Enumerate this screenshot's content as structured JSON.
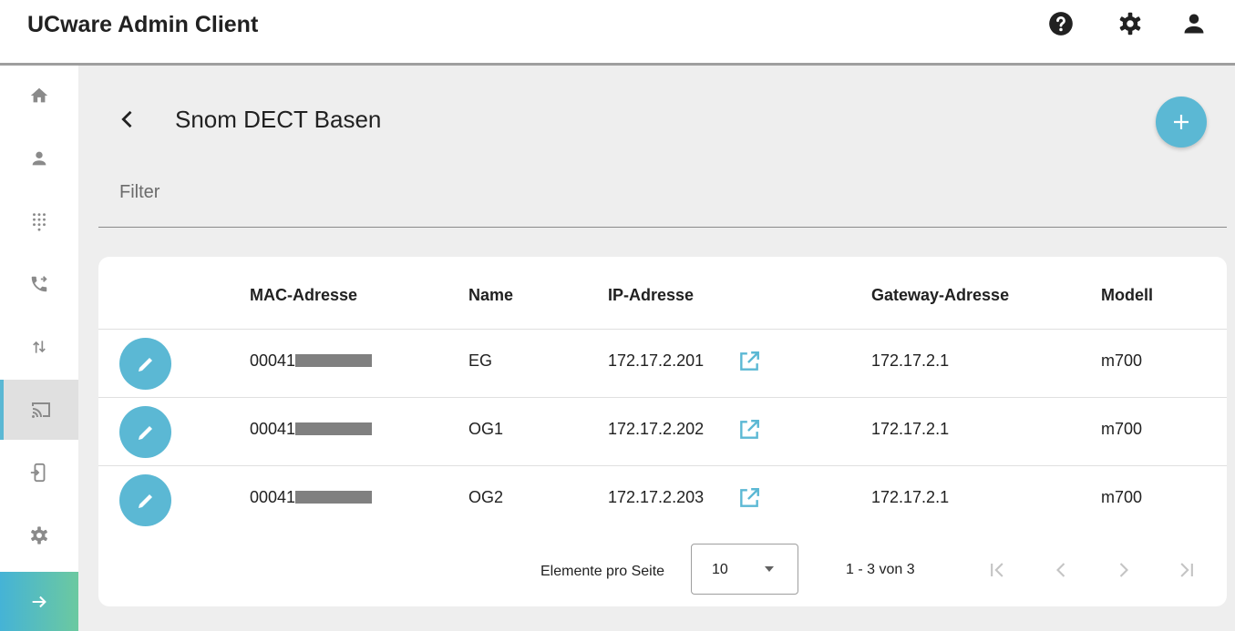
{
  "app": {
    "title": "UCware Admin Client"
  },
  "header": {
    "icons": [
      "help-icon",
      "settings-icon",
      "account-icon"
    ]
  },
  "sidebar": {
    "items": [
      "home-icon",
      "user-icon",
      "dialpad-icon",
      "call-forward-icon",
      "import-export-icon",
      "cast-icon",
      "device-provision-icon",
      "settings-icon"
    ],
    "active": "cast-icon",
    "expand_icon": "arrow-right-icon"
  },
  "page": {
    "title": "Snom DECT Basen",
    "filter_label": "Filter"
  },
  "table": {
    "columns": [
      "MAC-Adresse",
      "Name",
      "IP-Adresse",
      "Gateway-Adresse",
      "Modell"
    ],
    "rows": [
      {
        "mac_prefix": "00041",
        "name": "EG",
        "ip": "172.17.2.201",
        "gateway": "172.17.2.1",
        "model": "m700"
      },
      {
        "mac_prefix": "00041",
        "name": "OG1",
        "ip": "172.17.2.202",
        "gateway": "172.17.2.1",
        "model": "m700"
      },
      {
        "mac_prefix": "00041",
        "name": "OG2",
        "ip": "172.17.2.203",
        "gateway": "172.17.2.1",
        "model": "m700"
      }
    ]
  },
  "paginator": {
    "items_per_page_label": "Elemente pro Seite",
    "page_size": "10",
    "range_label": "1 - 3 von 3"
  },
  "colors": {
    "accent": "#5bb8d4",
    "accent_gradient_end": "#6cc9a0",
    "header_text": "#212121"
  }
}
